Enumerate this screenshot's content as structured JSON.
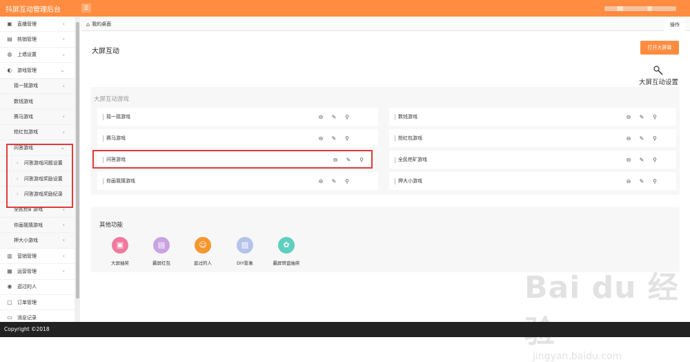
{
  "header": {
    "brand": "抖屏互动管理后台",
    "menu_icon": "hamburger-icon"
  },
  "sidebar": {
    "items": [
      {
        "label": "直播管理",
        "icon": "camera-icon",
        "chevron": "‹"
      },
      {
        "label": "核销管理",
        "icon": "ticket-icon",
        "chevron": "‹"
      },
      {
        "label": "上墙设置",
        "icon": "comment-icon",
        "chevron": "‹"
      },
      {
        "label": "游戏管理",
        "icon": "palette-icon",
        "chevron": "⌄"
      }
    ],
    "game_items": [
      {
        "label": "摇一摇游戏",
        "chevron": "‹"
      },
      {
        "label": "数钱游戏",
        "chevron": ""
      },
      {
        "label": "赛马游戏",
        "chevron": "‹"
      },
      {
        "label": "抢红包游戏",
        "chevron": "‹"
      },
      {
        "label": "问答游戏",
        "chevron": "⌄"
      }
    ],
    "qa_children": [
      {
        "label": "问答游戏问题设置",
        "arrow": "›"
      },
      {
        "label": "问答游戏奖励设置",
        "arrow": "›"
      },
      {
        "label": "问答游戏奖励纪录",
        "arrow": "›"
      }
    ],
    "more_games": [
      {
        "label": "全民挖矿游戏",
        "chevron": "‹"
      },
      {
        "label": "你画我猜游戏",
        "chevron": "‹"
      },
      {
        "label": "押大小游戏",
        "chevron": "‹"
      }
    ],
    "bottom_items": [
      {
        "label": "营销管理",
        "icon": "chart-icon",
        "chevron": "‹"
      },
      {
        "label": "运营管理",
        "icon": "list-icon",
        "chevron": "‹"
      },
      {
        "label": "逛过的人",
        "icon": "eye-icon",
        "chevron": ""
      },
      {
        "label": "订单管理",
        "icon": "clipboard-icon",
        "chevron": ""
      },
      {
        "label": "消息记录",
        "icon": "message-icon",
        "chevron": ""
      }
    ]
  },
  "tabs": {
    "home": "我的桌面",
    "ops": "操作"
  },
  "main": {
    "title": "大屏互动",
    "open_button": "打开大屏幕",
    "settings_label": "大屏互动设置",
    "section_label": "大屏互动游戏",
    "games_left": [
      "摇一摇游戏",
      "赛马游戏",
      "问答游戏",
      "你画我猜游戏"
    ],
    "games_right": [
      "数钱游戏",
      "抢红包游戏",
      "全民挖矿游戏",
      "押大小游戏"
    ],
    "other_title": "其他功能",
    "functions": [
      {
        "label": "大屏抽奖",
        "color": "#f07aa0",
        "icon": "gift-icon"
      },
      {
        "label": "霸屏红包",
        "color": "#c9a3e3",
        "icon": "redpacket-icon"
      },
      {
        "label": "逛过的人",
        "color": "#f5962f",
        "icon": "people-icon"
      },
      {
        "label": "DIY影象",
        "color": "#b5c3ea",
        "icon": "image-icon"
      },
      {
        "label": "霸屏转盘抽奖",
        "color": "#5fcfc0",
        "icon": "wheel-icon"
      }
    ]
  },
  "watermark": {
    "big": "Bai du 经验",
    "small": "jingyan.baidu.com"
  },
  "footer": {
    "text": "Copyright ©2018"
  },
  "colors": {
    "accent": "#ff8c40",
    "highlight": "#e03a3a"
  }
}
